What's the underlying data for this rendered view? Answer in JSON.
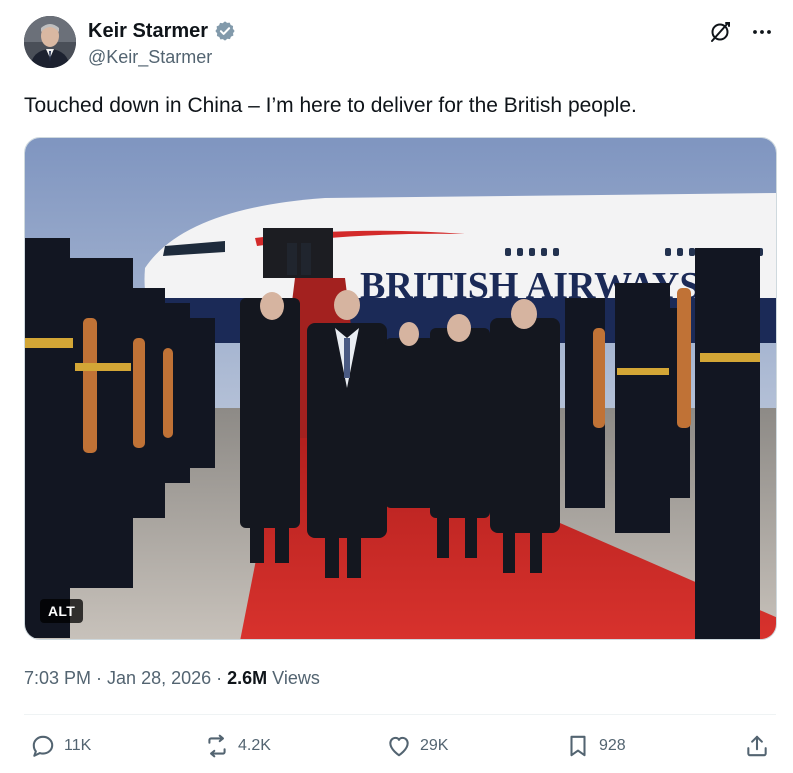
{
  "author": {
    "display_name": "Keir Starmer",
    "handle": "@Keir_Starmer",
    "verified_icon": "verified-badge-icon",
    "avatar_icon": "avatar"
  },
  "header_actions": [
    "grok-icon",
    "more-options-icon"
  ],
  "tweet": {
    "text": "Touched down in China – I’m here to deliver for the British people."
  },
  "media": {
    "alt_badge": "ALT",
    "aircraft_lettering": "BRITISH AIRWAYS"
  },
  "meta": {
    "time": "7:03 PM",
    "separator": " · ",
    "date": "Jan 28, 2026",
    "views_count": "2.6M",
    "views_label": " Views"
  },
  "actions": {
    "reply_count": "11K",
    "repost_count": "4.2K",
    "like_count": "29K",
    "bookmark_count": "928"
  },
  "colors": {
    "text_primary": "#0f1419",
    "text_secondary": "#536471",
    "verified": "#829aab",
    "divider": "#eff3f4"
  }
}
